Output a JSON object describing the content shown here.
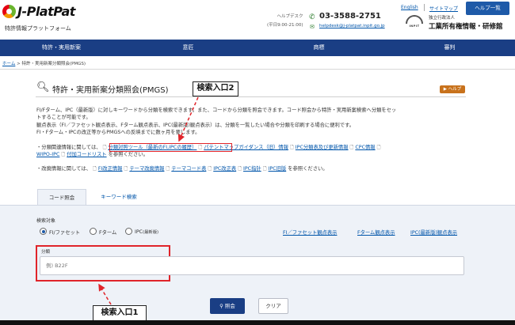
{
  "header": {
    "logo_text": "J-PlatPat",
    "logo_subtitle": "特許情報プラットフォーム",
    "help_desk_line1": "ヘルプデスク",
    "help_desk_line2": "(平日9:00-21:00)",
    "phone": "03-3588-2751",
    "email": "helpdesk@j-platpat.inpit.go.jp",
    "link_english": "English",
    "link_sitemap": "サイトマップ",
    "help_list_label": "ヘルプ一覧",
    "org_small": "独立行政法人",
    "org_large": "工業所有権情報・研修館",
    "inpit_label": "INPIT"
  },
  "nav": {
    "items": [
      "特許・実用新案",
      "意匠",
      "商標",
      "審判"
    ]
  },
  "breadcrumb": {
    "home": "ホーム",
    "current": "特許・実用新案分類照会(PMGS)"
  },
  "page": {
    "title": "特許・実用新案分類照会(PMGS)",
    "help_badge": "▶ ヘルプ",
    "annotation_top": "検索入口2",
    "annotation_bottom": "検索入口1"
  },
  "description": {
    "line1": "FI/Fターム、IPC（最新版）に対しキーワードから分類を検索できます。また、コードから分類を照会できます。コード照会から特許・実用新案検索へ分類をセッ",
    "line2": "トすることが可能です。",
    "line3": "観点表示（FI／ファセット観点表示、Fターム観点表示、IPC(最新版)観点表示）は、分類を一覧したい場合や分類を印刷する場合に便利です。",
    "line4": "FI・Fターム・IPCの改正等からPMGSへの反映までに数ヶ月を要します。",
    "related_prefix": "・分類関連情報に関しては、",
    "related_links": [
      "分類対照ツール（最新のFI,IPCの履歴）",
      "パテントマップガイダンス（旧）情報",
      "IPC分類表及び更新情報",
      "CPC情報"
    ],
    "related_links_line2": [
      "WIPO-IPC",
      "付加コードリスト"
    ],
    "related_suffix": "を参照ください。",
    "revision_prefix": "・改廃情報に関しては、",
    "revision_links": [
      "FI改正情報",
      "テーマ改廃情報",
      "テーマコード表",
      "IPC改正表",
      "IPC指针",
      "IPC旧版"
    ],
    "revision_suffix": "を参照ください。"
  },
  "tabs": {
    "code": "コード照会",
    "keyword": "キーワード検索"
  },
  "form": {
    "target_label": "検索対象",
    "radio_fi": "FI/ファセット",
    "radio_fterm": "Fターム",
    "radio_ipc": "IPC",
    "radio_ipc_suffix": "(最新版)",
    "selected": "FI/ファセット",
    "view_links": [
      "FI／ファセット観点表示",
      "Fターム観点表示",
      "IPC(最新版)観点表示"
    ],
    "input_label": "分類",
    "input_placeholder": "例) B22F",
    "search_button": "照会",
    "clear_button": "クリア"
  }
}
